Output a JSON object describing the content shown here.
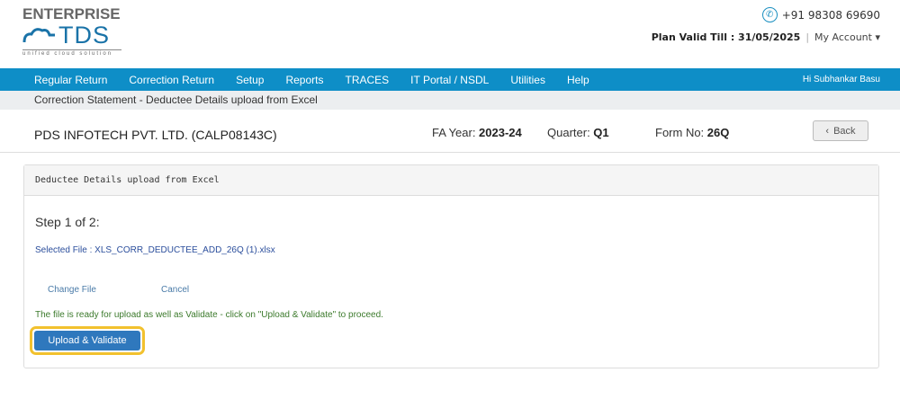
{
  "logo": {
    "line1": "ENTERPRISE",
    "line2": "TDS",
    "tagline": "unified cloud solution"
  },
  "header": {
    "phone": "+91 98308 69690",
    "plan": "Plan Valid Till : 31/05/2025",
    "separator": "|",
    "account": "My Account",
    "account_caret": "▾"
  },
  "nav": {
    "items": [
      "Regular Return",
      "Correction Return",
      "Setup",
      "Reports",
      "TRACES",
      "IT Portal / NSDL",
      "Utilities",
      "Help"
    ],
    "greeting": "Hi Subhankar Basu"
  },
  "breadcrumb": "Correction Statement - Deductee Details upload from Excel",
  "info": {
    "company": "PDS INFOTECH PVT. LTD. (CALP08143C)",
    "fy_label": "FA Year: ",
    "fy": "2023-24",
    "q_label": "Quarter: ",
    "q": "Q1",
    "form_label": "Form No: ",
    "form": "26Q",
    "back": "Back"
  },
  "panel": {
    "title": "Deductee Details upload from Excel",
    "step": "Step 1 of 2:",
    "file": "Selected File : XLS_CORR_DEDUCTEE_ADD_26Q (1).xlsx",
    "change": "Change File",
    "cancel": "Cancel",
    "message": "The file is ready for upload as well as Validate - click on \"Upload & Validate\" to proceed.",
    "upload": "Upload & Validate"
  },
  "colors": {
    "nav": "#0e8ec7",
    "button": "#2f78bd",
    "highlight": "#f2c12e",
    "message": "#3c7a2c"
  }
}
